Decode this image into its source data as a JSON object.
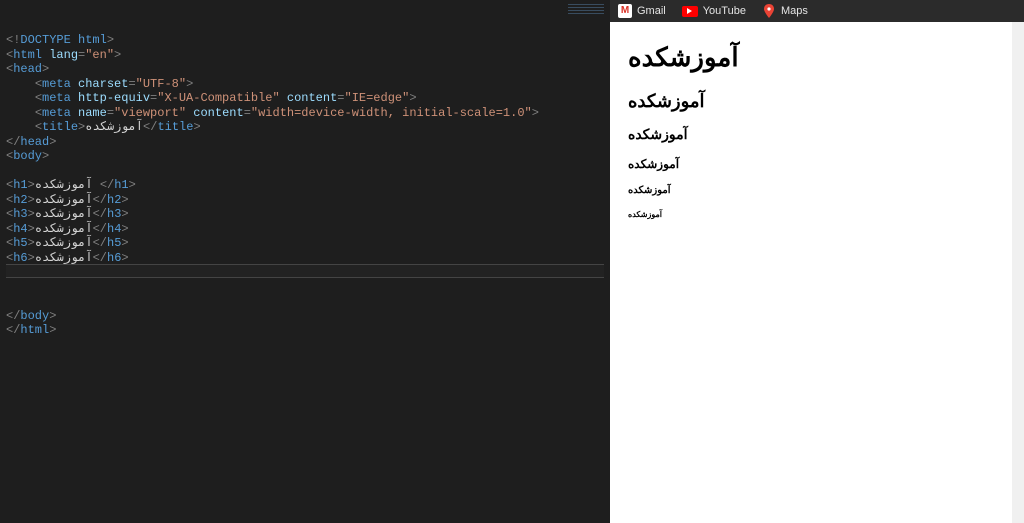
{
  "code": {
    "doctype": "DOCTYPE html",
    "html_tag": "html",
    "lang_attr": "lang",
    "lang_val": "\"en\"",
    "head_tag": "head",
    "meta_tag": "meta",
    "charset_attr": "charset",
    "charset_val": "\"UTF-8\"",
    "httpequiv_attr": "http-equiv",
    "httpequiv_val": "\"X-UA-Compatible\"",
    "content_attr": "content",
    "ie_val": "\"IE=edge\"",
    "name_attr": "name",
    "viewport_val": "\"viewport\"",
    "viewport_content_val": "\"width=device-width, initial-scale=1.0\"",
    "title_tag": "title",
    "title_text": "آموزشکده",
    "body_tag": "body",
    "h1": "h1",
    "h2": "h2",
    "h3": "h3",
    "h4": "h4",
    "h5": "h5",
    "h6": "h6",
    "heading_text": "آموزشکده ",
    "heading_text2": "آموزشکده"
  },
  "bookmarks": {
    "gmail": "Gmail",
    "youtube": "YouTube",
    "maps": "Maps"
  },
  "preview": {
    "h1": "آموزشکده",
    "h2": "آموزشکده",
    "h3": "آموزشکده",
    "h4": "آموزشکده",
    "h5": "آموزشکده",
    "h6": "آموزشکده"
  }
}
